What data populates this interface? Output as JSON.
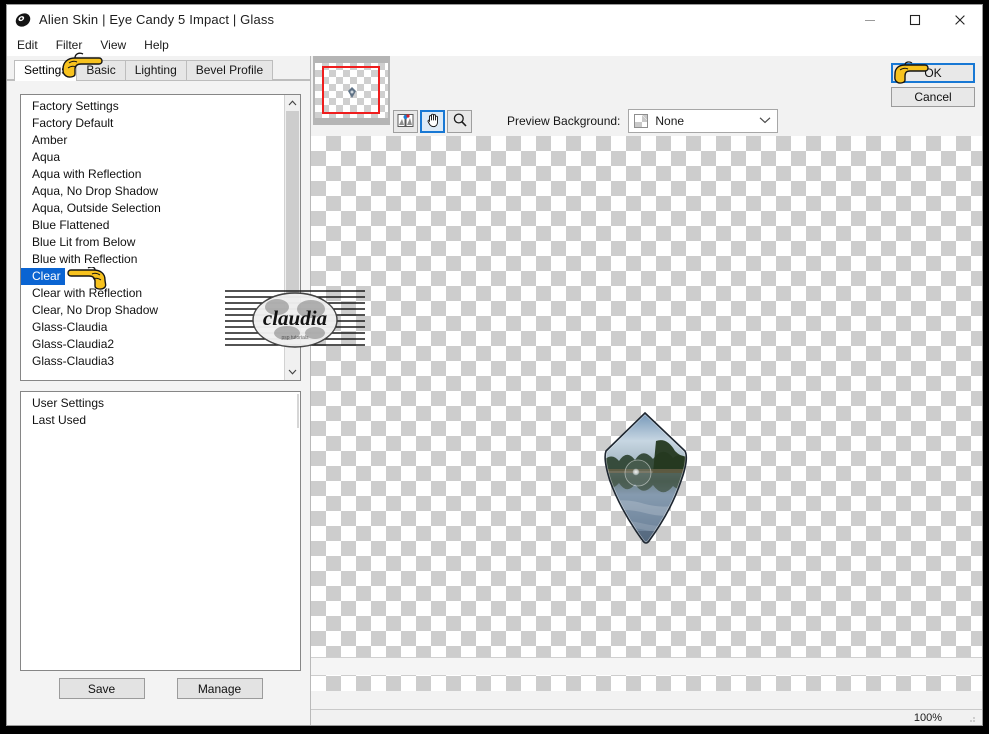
{
  "window": {
    "title": "Alien Skin | Eye Candy 5 Impact | Glass",
    "logo_icon": "alienskin-logo-icon",
    "controls": [
      {
        "name": "minimize",
        "icon": "minimize-icon"
      },
      {
        "name": "maximize",
        "icon": "maximize-icon"
      },
      {
        "name": "close",
        "icon": "close-icon"
      }
    ]
  },
  "menu": {
    "items": [
      {
        "label": "Edit"
      },
      {
        "label": "Filter"
      },
      {
        "label": "View"
      },
      {
        "label": "Help"
      }
    ]
  },
  "tabs": [
    {
      "label": "Settings",
      "active": true
    },
    {
      "label": "Basic",
      "active": false
    },
    {
      "label": "Lighting",
      "active": false
    },
    {
      "label": "Bevel Profile",
      "active": false
    }
  ],
  "factory_list": {
    "items": [
      "Factory Settings",
      "Factory Default",
      "Amber",
      "Aqua",
      "Aqua with Reflection",
      "Aqua, No Drop Shadow",
      "Aqua, Outside Selection",
      "Blue Flattened",
      "Blue Lit from Below",
      "Blue with Reflection",
      "Clear",
      "Clear with Reflection",
      "Clear, No Drop Shadow",
      "Glass-Claudia",
      "Glass-Claudia2",
      "Glass-Claudia3"
    ],
    "selected": "Clear",
    "selected_index": 10,
    "selection_color": "#0a64d2",
    "scroll_up_icon": "chevron-up-icon",
    "scroll_down_icon": "chevron-down-icon"
  },
  "user_list": {
    "items": [
      "User Settings",
      "Last Used"
    ]
  },
  "bottom_buttons": {
    "save_label": "Save",
    "manage_label": "Manage"
  },
  "toolbar": {
    "navigator_name": "navigator-thumbnail",
    "viewport_color": "#ef1d1d",
    "tools": [
      {
        "name": "preview-compare-tool",
        "icon": "compare-preview-icon",
        "active": false
      },
      {
        "name": "pan-tool",
        "icon": "hand-icon",
        "active": true
      },
      {
        "name": "zoom-tool",
        "icon": "magnifier-icon",
        "active": false
      }
    ],
    "preview_background_label": "Preview Background:",
    "preview_background_value": "None",
    "preview_background_options": [
      "None"
    ],
    "dropdown_icon": "chevron-down-icon",
    "swatch_icon": "checkerboard-swatch-icon"
  },
  "actions": {
    "ok_label": "OK",
    "cancel_label": "Cancel",
    "focus_color": "#1878d4"
  },
  "preview": {
    "object_name": "glass-shield-object",
    "watermark_text": "claudia"
  },
  "status": {
    "zoom_level": "100%"
  },
  "annotations": {
    "hand_cursor_icon": "pointing-hand-icon",
    "count": 3
  }
}
